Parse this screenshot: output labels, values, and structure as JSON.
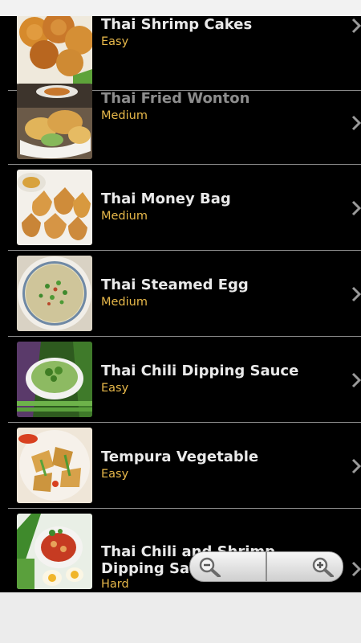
{
  "recipes": [
    {
      "name": "Thai Shrimp Cakes",
      "difficulty": "Easy",
      "image": "shrimp-cakes-photo"
    },
    {
      "name": "Thai Fried Wonton",
      "difficulty": "Medium",
      "image": "fried-wonton-photo"
    },
    {
      "name": "Thai Money Bag",
      "difficulty": "Medium",
      "image": "money-bag-photo"
    },
    {
      "name": "Thai Steamed Egg",
      "difficulty": "Medium",
      "image": "steamed-egg-photo"
    },
    {
      "name": "Thai Chili Dipping Sauce",
      "difficulty": "Easy",
      "image": "chili-dipping-sauce-photo"
    },
    {
      "name": "Tempura Vegetable",
      "difficulty": "Easy",
      "image": "tempura-vegetable-photo"
    },
    {
      "name": "Thai Chili and Shrimp Dipping Sauce",
      "difficulty": "Hard",
      "image": "chili-shrimp-sauce-photo"
    }
  ],
  "zoom_controls": {
    "zoom_out_icon": "zoom-out-icon",
    "zoom_in_icon": "zoom-in-icon"
  },
  "colors": {
    "list_background": "#000000",
    "title": "#e9e9e9",
    "difficulty": "#e7b84a",
    "divider": "#8a8a8a"
  }
}
